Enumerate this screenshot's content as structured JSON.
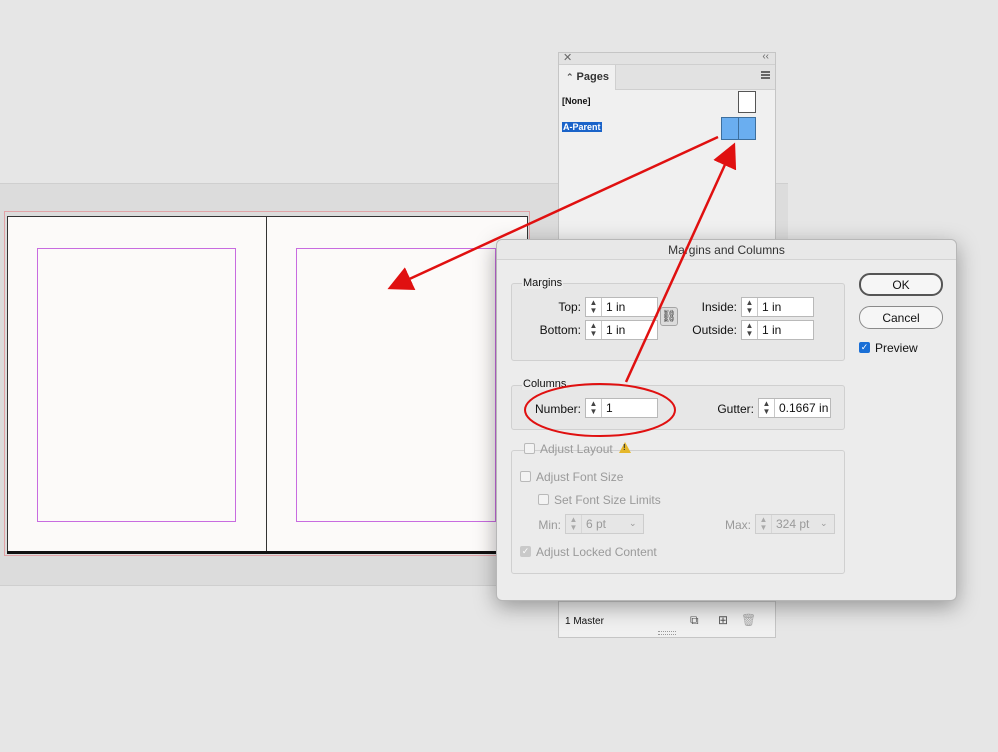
{
  "pages_panel": {
    "tab_label": "Pages",
    "items": [
      {
        "label": "[None]"
      },
      {
        "label": "A-Parent"
      }
    ],
    "footer_count": "1 Master"
  },
  "dialog": {
    "title": "Margins and Columns",
    "margins": {
      "group_label": "Margins",
      "top_label": "Top:",
      "top_value": "1 in",
      "bottom_label": "Bottom:",
      "bottom_value": "1 in",
      "inside_label": "Inside:",
      "inside_value": "1 in",
      "outside_label": "Outside:",
      "outside_value": "1 in"
    },
    "columns": {
      "group_label": "Columns",
      "number_label": "Number:",
      "number_value": "1",
      "gutter_label": "Gutter:",
      "gutter_value": "0.1667 in"
    },
    "adjust_layout": {
      "label": "Adjust Layout",
      "font_size_label": "Adjust Font Size",
      "font_limits_label": "Set Font Size Limits",
      "min_label": "Min:",
      "min_value": "6 pt",
      "max_label": "Max:",
      "max_value": "324 pt",
      "locked_content_label": "Adjust Locked Content"
    },
    "ok_label": "OK",
    "cancel_label": "Cancel",
    "preview_label": "Preview",
    "preview_checked": true
  },
  "colors": {
    "annotation": "#e01010",
    "selection": "#1a63c9",
    "margin_guide": "#c86be0"
  }
}
